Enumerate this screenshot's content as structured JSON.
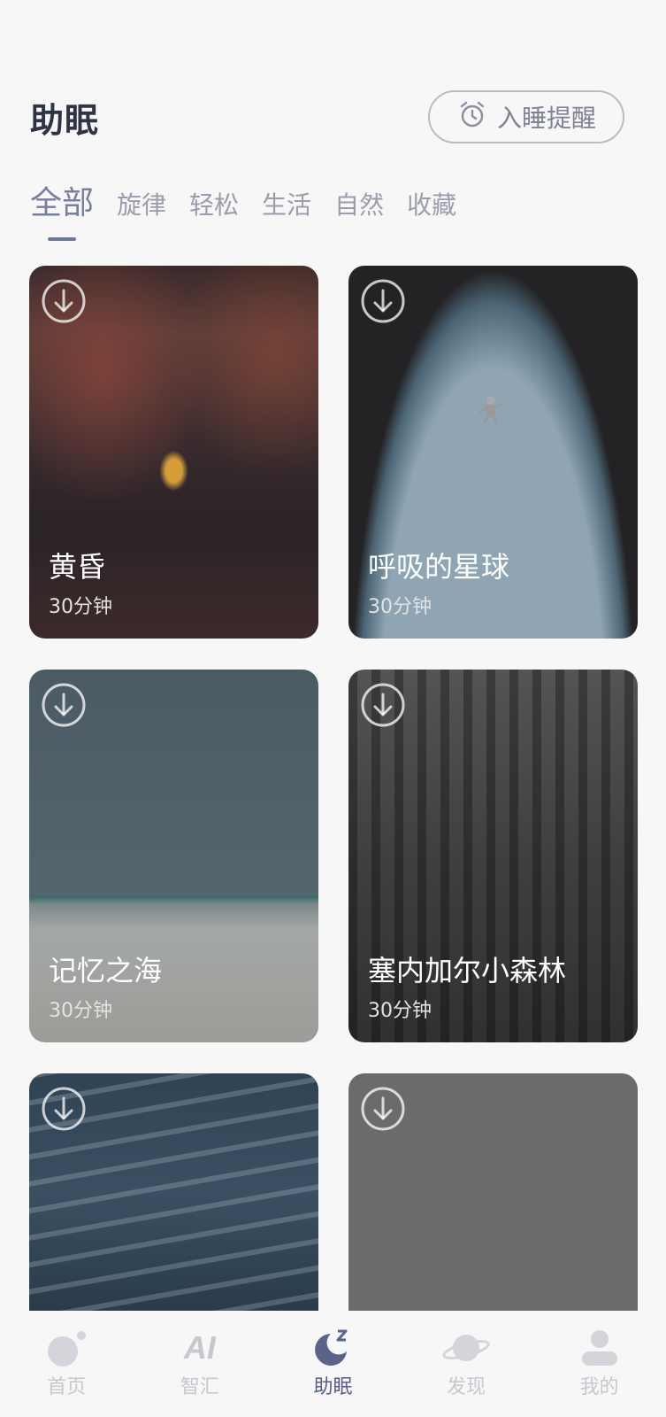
{
  "header": {
    "title": "助眠",
    "reminder_label": "入睡提醒",
    "reminder_icon": "alarm-clock-icon"
  },
  "tabs": [
    {
      "label": "全部",
      "active": true
    },
    {
      "label": "旋律",
      "active": false
    },
    {
      "label": "轻松",
      "active": false
    },
    {
      "label": "生活",
      "active": false
    },
    {
      "label": "自然",
      "active": false
    },
    {
      "label": "收藏",
      "active": false
    }
  ],
  "cards": [
    {
      "title": "黄昏",
      "duration": "30分钟",
      "icon": "download-icon"
    },
    {
      "title": "呼吸的星球",
      "duration": "30分钟",
      "icon": "download-icon"
    },
    {
      "title": "记忆之海",
      "duration": "30分钟",
      "icon": "download-icon"
    },
    {
      "title": "塞内加尔小森林",
      "duration": "30分钟",
      "icon": "download-icon"
    },
    {
      "icon": "download-icon"
    },
    {
      "icon": "download-icon"
    }
  ],
  "bottom_nav": [
    {
      "label": "首页",
      "icon": "home-planet-icon",
      "active": false
    },
    {
      "label": "智汇",
      "icon_text": "AI",
      "active": false
    },
    {
      "label": "助眠",
      "icon": "sleep-moon-icon",
      "active": true
    },
    {
      "label": "发现",
      "icon": "planet-ring-icon",
      "active": false
    },
    {
      "label": "我的",
      "icon": "user-icon",
      "active": false
    }
  ],
  "colors": {
    "accent": "#566083",
    "background": "#f7f7f8",
    "inactive": "#c6c8ce"
  }
}
